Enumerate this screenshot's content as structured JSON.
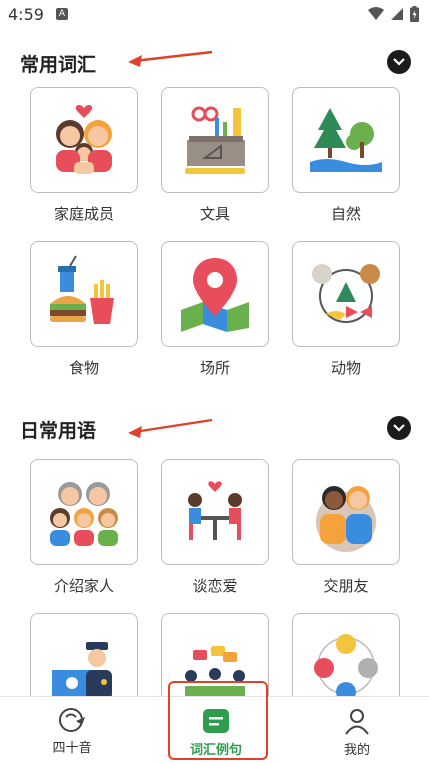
{
  "status_bar": {
    "time": "4:59",
    "notification_letter": "A"
  },
  "sections": [
    {
      "title": "常用词汇",
      "items": [
        {
          "label": "家庭成员",
          "icon": "family-icon"
        },
        {
          "label": "文具",
          "icon": "stationery-icon"
        },
        {
          "label": "自然",
          "icon": "nature-icon"
        },
        {
          "label": "食物",
          "icon": "food-icon"
        },
        {
          "label": "场所",
          "icon": "location-pin-icon"
        },
        {
          "label": "动物",
          "icon": "animals-icon"
        }
      ]
    },
    {
      "title": "日常用语",
      "items": [
        {
          "label": "介绍家人",
          "icon": "family-group-icon"
        },
        {
          "label": "谈恋爱",
          "icon": "dating-icon"
        },
        {
          "label": "交朋友",
          "icon": "friends-icon"
        },
        {
          "label": "",
          "icon": "police-icon"
        },
        {
          "label": "",
          "icon": "meeting-icon"
        },
        {
          "label": "",
          "icon": "emotions-icon"
        }
      ]
    }
  ],
  "bottom_nav": [
    {
      "label": "四十音",
      "icon": "kana-icon",
      "active": false
    },
    {
      "label": "词汇例句",
      "icon": "vocabulary-icon",
      "active": true
    },
    {
      "label": "我的",
      "icon": "profile-icon",
      "active": false
    }
  ],
  "colors": {
    "accent": "#2e9e4e",
    "annotation": "#e0412a"
  }
}
